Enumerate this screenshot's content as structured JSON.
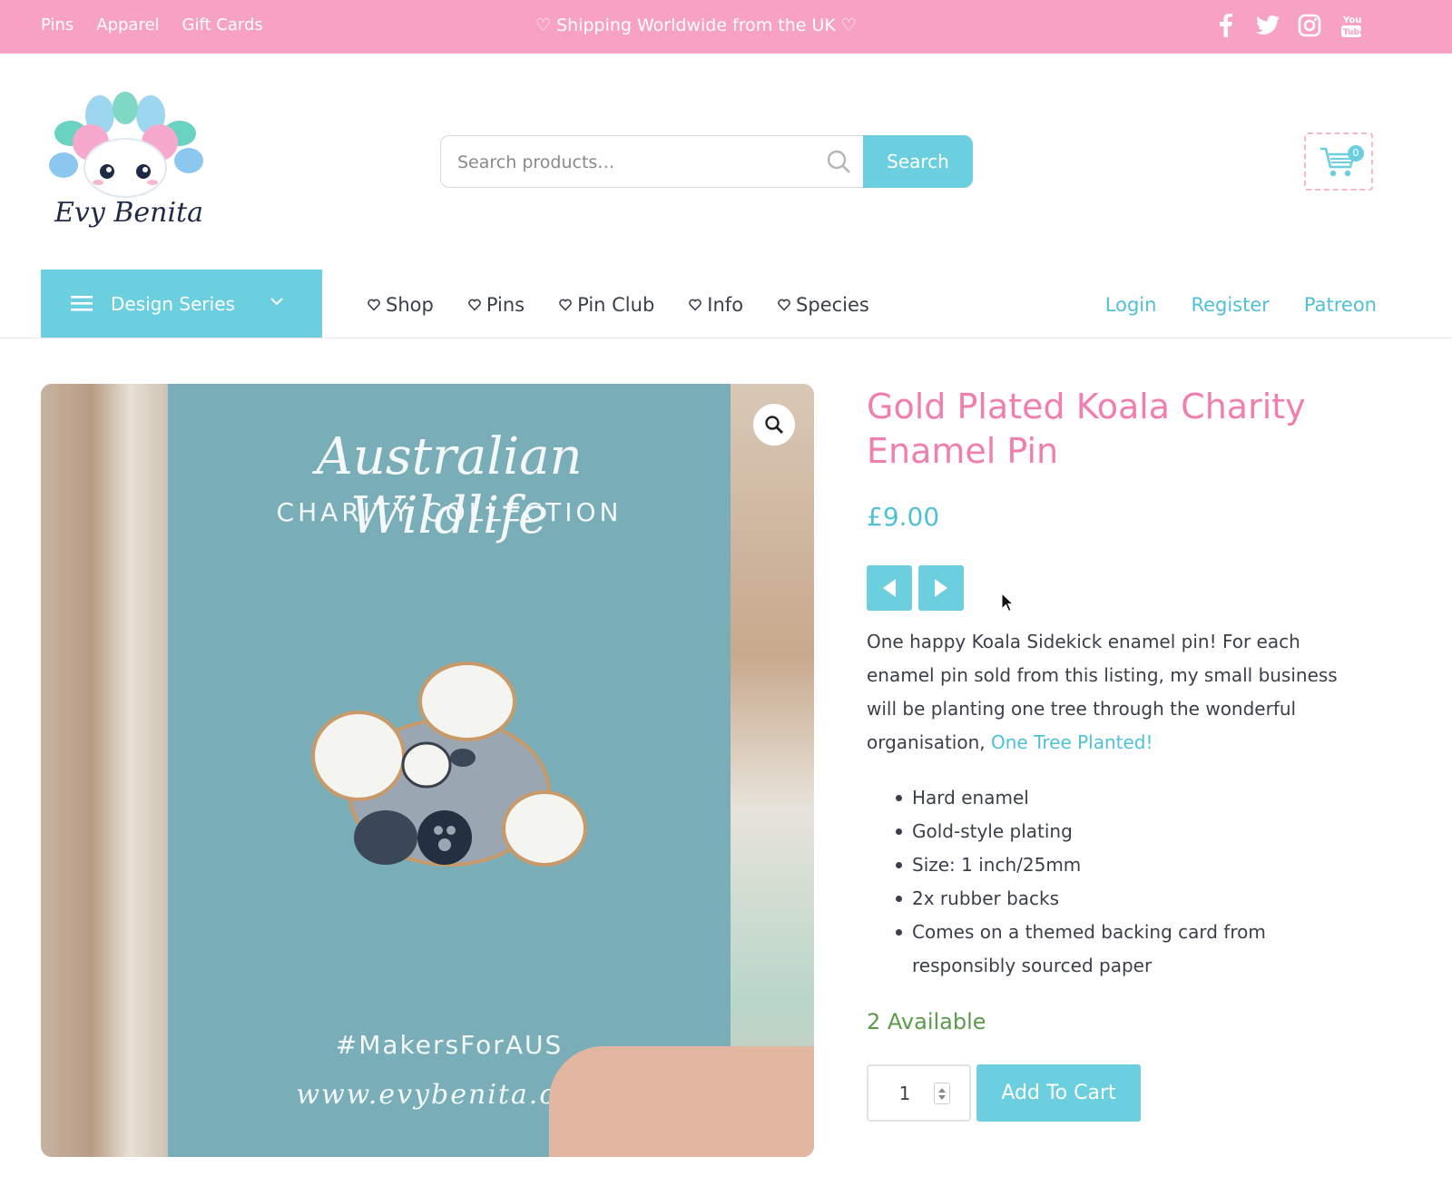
{
  "topbar": {
    "links": [
      "Pins",
      "Apparel",
      "Gift Cards"
    ],
    "promo": "♡ Shipping Worldwide from the UK ♡",
    "social": [
      "facebook-icon",
      "twitter-icon",
      "instagram-icon",
      "youtube-icon"
    ],
    "bg_color": "#f7a1c4"
  },
  "header": {
    "logo_text": "Evy Benita",
    "search_placeholder": "Search products…",
    "search_button": "Search",
    "cart_count": "0"
  },
  "nav": {
    "design_series": "Design Series",
    "main": [
      "Shop",
      "Pins",
      "Pin Club",
      "Info",
      "Species"
    ],
    "right": [
      "Login",
      "Register",
      "Patreon"
    ],
    "accent_color": "#6ccfe0"
  },
  "product": {
    "image": {
      "card_title": "Australian Wildlife",
      "card_subtitle": "CHARITY COLLECTION",
      "card_tag": "#MakersForAUS",
      "card_url": "www.evybenita.com"
    },
    "title": "Gold Plated Koala Charity Enamel Pin",
    "price": "£9.00",
    "description": "One happy Koala Sidekick enamel pin! For each enamel pin sold from this listing, my small business will be planting one tree through the wonderful organisation,",
    "description_link": "One Tree Planted!",
    "features": [
      "Hard enamel",
      "Gold-style plating",
      "Size: 1 inch/25mm",
      "2x rubber backs",
      "Comes on a themed backing card from responsibly sourced paper"
    ],
    "stock": "2 Available",
    "quantity": "1",
    "add_to_cart": "Add To Cart",
    "title_color": "#f07fb0",
    "price_color": "#4fc1d6",
    "stock_color": "#5d9b4a"
  }
}
